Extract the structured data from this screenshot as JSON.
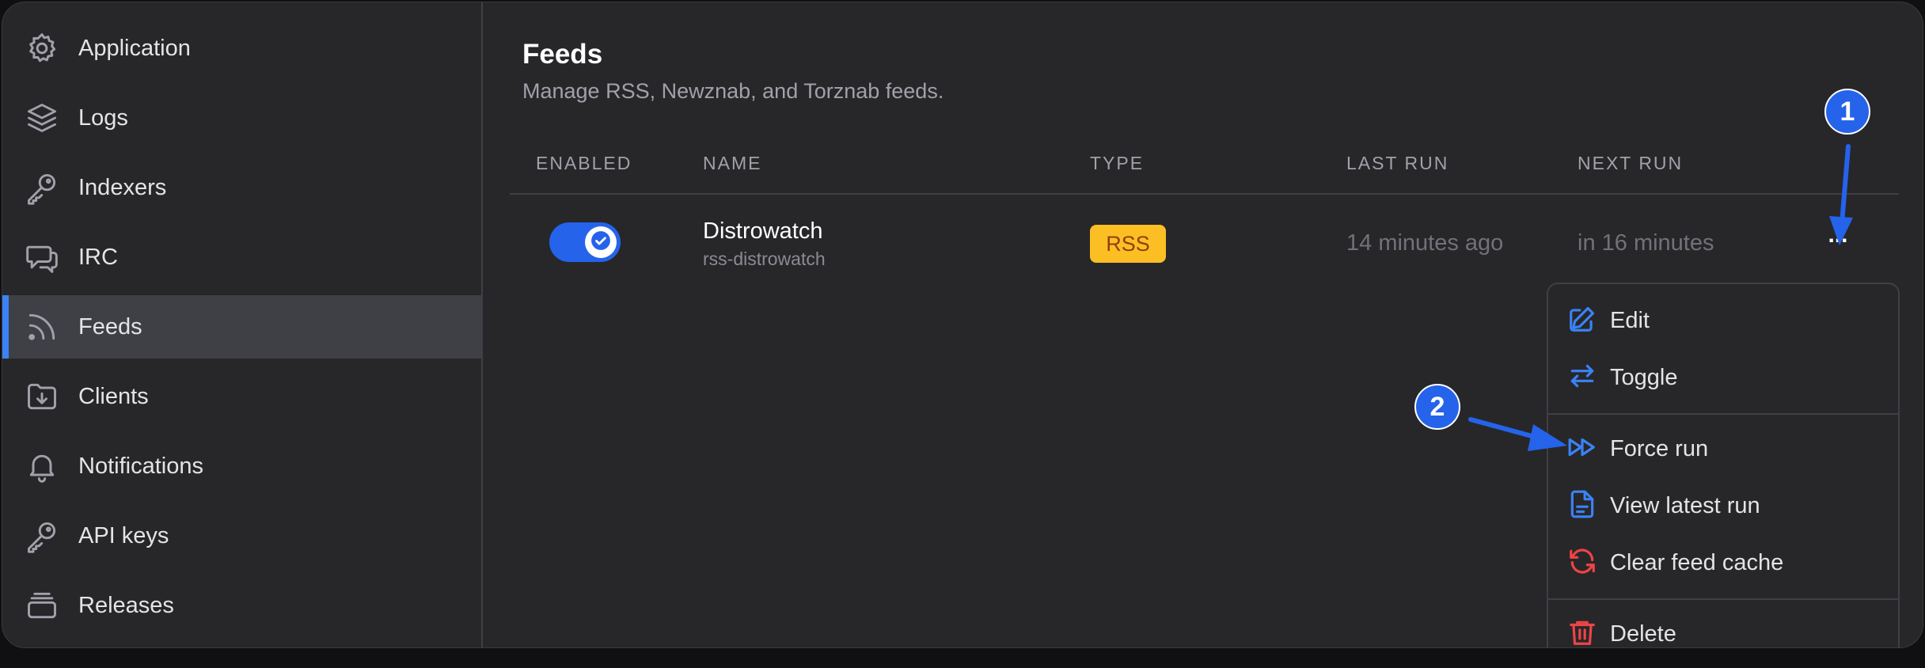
{
  "sidebar": {
    "items": [
      {
        "label": "Application",
        "icon": "gear-icon"
      },
      {
        "label": "Logs",
        "icon": "layers-icon"
      },
      {
        "label": "Indexers",
        "icon": "key-icon"
      },
      {
        "label": "IRC",
        "icon": "chat-bubbles-icon"
      },
      {
        "label": "Feeds",
        "icon": "rss-icon",
        "active": true
      },
      {
        "label": "Clients",
        "icon": "folder-download-icon"
      },
      {
        "label": "Notifications",
        "icon": "bell-icon"
      },
      {
        "label": "API keys",
        "icon": "key-icon"
      },
      {
        "label": "Releases",
        "icon": "archive-box-icon"
      }
    ]
  },
  "main": {
    "title": "Feeds",
    "subtitle": "Manage RSS, Newznab, and Torznab feeds.",
    "columns": [
      "ENABLED",
      "NAME",
      "TYPE",
      "LAST RUN",
      "NEXT RUN"
    ],
    "rows": [
      {
        "enabled": true,
        "name": "Distrowatch",
        "identifier": "rss-distrowatch",
        "type": "RSS",
        "last_run": "14 minutes ago",
        "next_run": "in 16 minutes",
        "actions_label": "..."
      }
    ]
  },
  "menu": {
    "items": [
      {
        "label": "Edit",
        "icon": "pencil-square-icon"
      },
      {
        "label": "Toggle",
        "icon": "arrows-right-left-icon"
      },
      {
        "label": "Force run",
        "icon": "forward-icon"
      },
      {
        "label": "View latest run",
        "icon": "document-text-icon"
      },
      {
        "label": "Clear feed cache",
        "icon": "arrow-path-icon"
      },
      {
        "label": "Delete",
        "icon": "trash-icon"
      }
    ]
  },
  "annotations": {
    "step1": "1",
    "step2": "2"
  },
  "colors": {
    "accent": "#2563eb",
    "menu_icon": "#3b82f6",
    "danger": "#ef4444",
    "rss_badge": "#fbbf24"
  }
}
